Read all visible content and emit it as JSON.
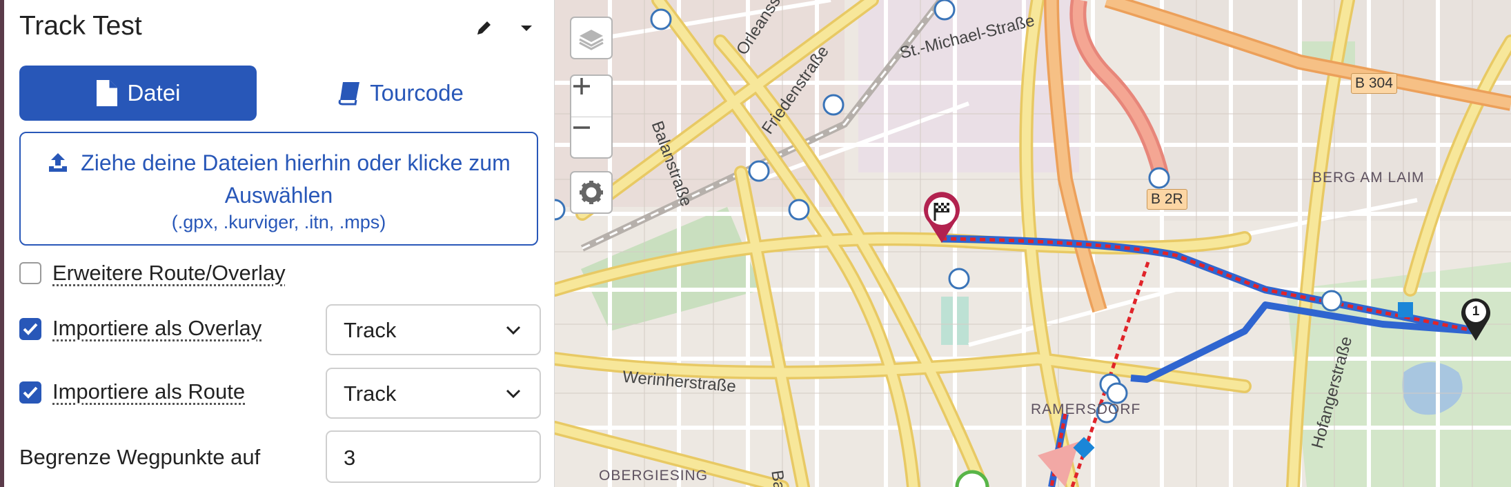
{
  "panel": {
    "title": "Track Test",
    "tabs": [
      {
        "label": "Datei",
        "icon": "file-icon",
        "active": true
      },
      {
        "label": "Tourcode",
        "icon": "book-icon",
        "active": false
      }
    ],
    "dropzone": {
      "text": "Ziehe deine Dateien hierhin oder klicke zum Auswählen",
      "hint": "(.gpx, .kurviger, .itn, .mps)"
    },
    "options": {
      "extended_route": {
        "label": "Erweitere Route/Overlay",
        "checked": false
      },
      "import_overlay": {
        "label": "Importiere als Overlay",
        "checked": true,
        "select_value": "Track"
      },
      "import_route": {
        "label": "Importiere als Route",
        "checked": true,
        "select_value": "Track"
      },
      "limit_waypoints": {
        "label": "Begrenze Wegpunkte auf",
        "value": "3"
      }
    }
  },
  "map": {
    "controls": [
      "layers-icon",
      "zoom-in-icon",
      "zoom-out-icon",
      "gear-icon"
    ],
    "labels": {
      "orleansstrasse": "Orleansstraße",
      "friedenstrasse": "Friedenstraße",
      "balanstrasse": "Balanstraße",
      "balanstrasse_short": "Bala",
      "werinherstrasse": "Werinherstraße",
      "hofangerstrasse": "Hofangerstraße",
      "st_michael_strasse": "St.-Michael-Straße",
      "berg_am_laim": "BERG AM LAIM",
      "ramersdorf": "RAMERSDORF",
      "obergiesing": "OBERGIESING"
    },
    "shields": {
      "b304": "B 304",
      "b2r": "B 2R"
    },
    "waypoint_number": "1",
    "colors": {
      "route": "#2f65d0",
      "overlay": "#e0242a",
      "accent": "#2857b8"
    }
  }
}
